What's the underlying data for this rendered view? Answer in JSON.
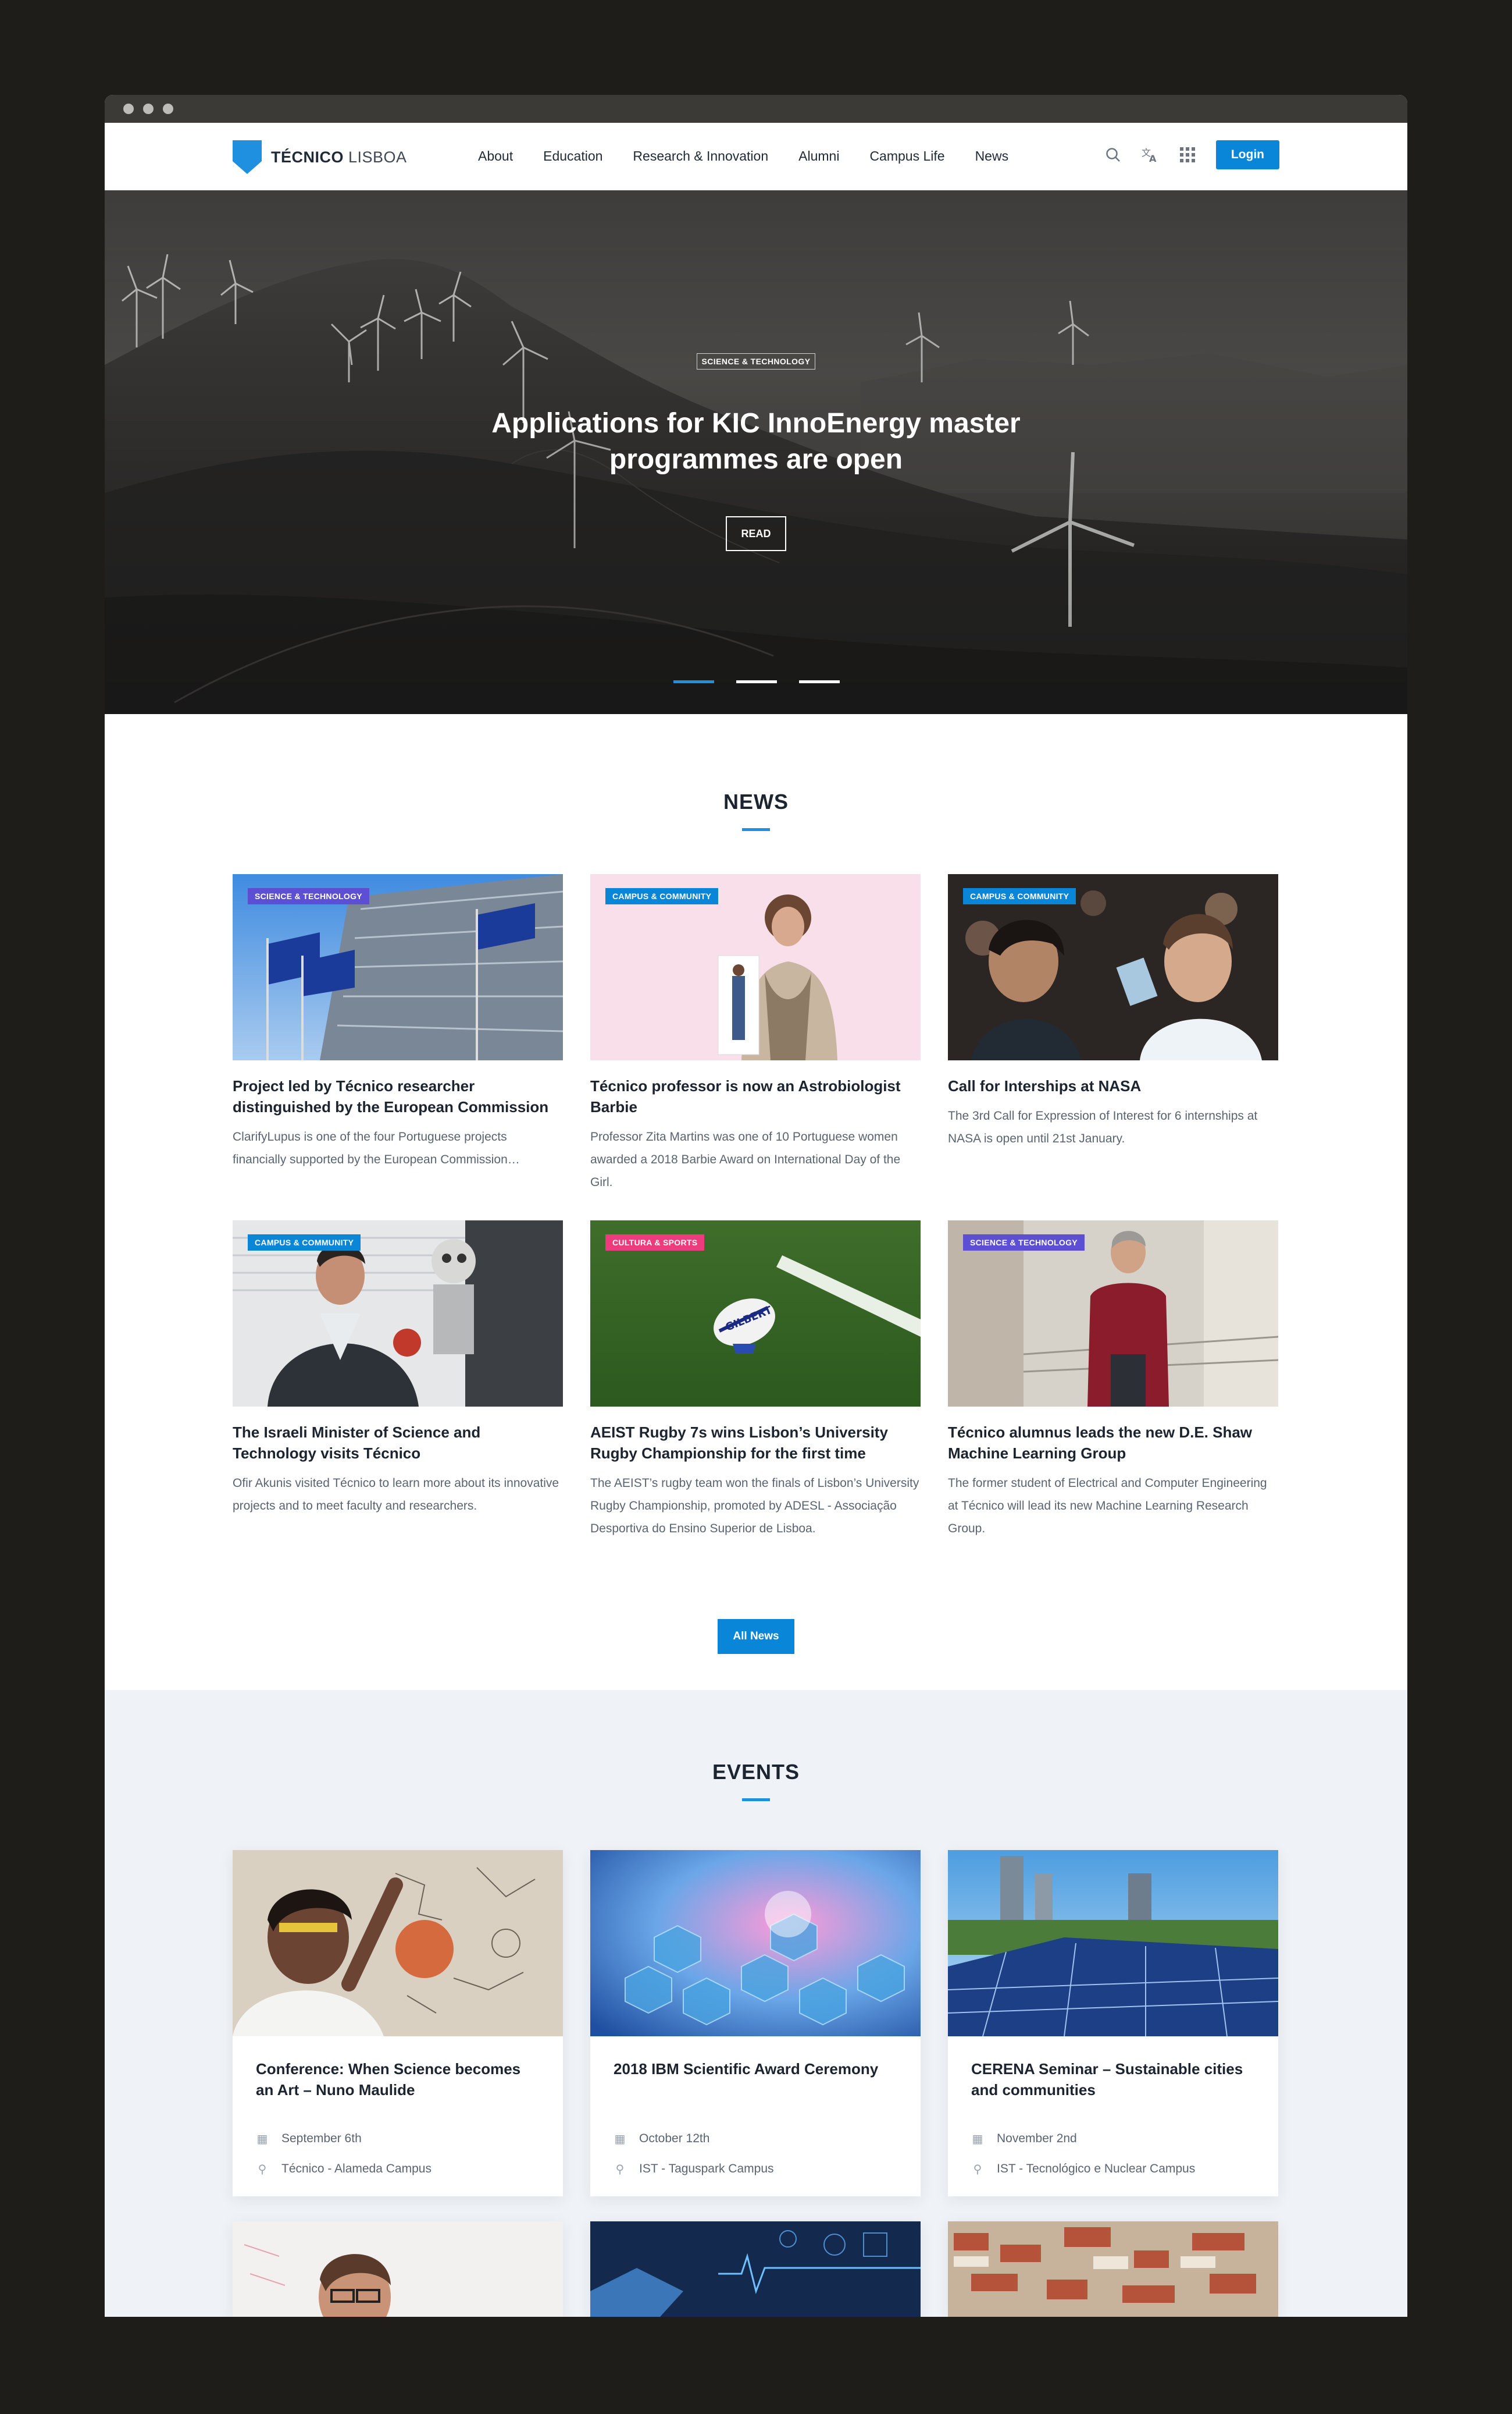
{
  "brand": {
    "name_bold": "TÉCNICO",
    "name_light": " LISBOA",
    "monogram": "IST"
  },
  "nav": [
    "About",
    "Education",
    "Research & Innovation",
    "Alumni",
    "Campus Life",
    "News"
  ],
  "header": {
    "login_label": "Login",
    "icons": [
      "search-icon",
      "translate-icon",
      "apps-grid-icon"
    ]
  },
  "hero": {
    "tag": "SCIENCE & TECHNOLOGY",
    "title_line1": "Applications for KIC InnoEnergy master",
    "title_line2": "programmes are open",
    "read_label": "READ",
    "slides": 3,
    "active_slide": 1
  },
  "news": {
    "title": "NEWS",
    "items": [
      {
        "tag": "SCIENCE & TECHNOLOGY",
        "title": "Project led by Técnico researcher distinguished by the European Commission",
        "text": "ClarifyLupus is one of the four Portuguese projects financially supported by the European Commission…"
      },
      {
        "tag": "CAMPUS & COMMUNITY",
        "title": "Técnico professor is now an Astrobiologist Barbie",
        "text": "Professor Zita Martins was one of 10 Portuguese women awarded a 2018 Barbie Award on International Day of the Girl."
      },
      {
        "tag": "CAMPUS & COMMUNITY",
        "title": "Call for Interships at NASA",
        "text": "The 3rd Call for Expression of Interest for 6 internships at NASA is open until 21st January."
      },
      {
        "tag": "CAMPUS & COMMUNITY",
        "title": "The Israeli Minister of Science and Technology visits Técnico",
        "text": "Ofir Akunis visited Técnico to learn more about its innovative projects and to meet faculty and researchers."
      },
      {
        "tag": "CULTURA & SPORTS",
        "title": "AEIST Rugby 7s wins Lisbon’s University Rugby Championship for the first time",
        "text": "The AEIST’s rugby team won the finals of Lisbon’s University Rugby Championship, promoted by ADESL - Associação Desportiva do Ensino Superior de Lisboa."
      },
      {
        "tag": "SCIENCE & TECHNOLOGY",
        "title": "Técnico alumnus leads the new D.E. Shaw Machine Learning Group",
        "text": "The former student of Electrical and Computer Engineering at Técnico will lead its new Machine Learning Research Group."
      }
    ],
    "all_label": "All News"
  },
  "events": {
    "title": "EVENTS",
    "items": [
      {
        "title": "Conference: When Science becomes an Art – Nuno Maulide",
        "date": "September 6th",
        "place": "Técnico - Alameda Campus"
      },
      {
        "title": "2018 IBM Scientific Award Ceremony",
        "date": "October 12th",
        "place": "IST - Taguspark Campus"
      },
      {
        "title": "CERENA Seminar – Sustainable cities and communities",
        "date": "November 2nd",
        "place": "IST - Tecnológico e Nuclear Campus"
      }
    ]
  },
  "colors": {
    "accent": "#0a86d9",
    "science": "#5d4fd3",
    "culture": "#ee3b7c"
  }
}
